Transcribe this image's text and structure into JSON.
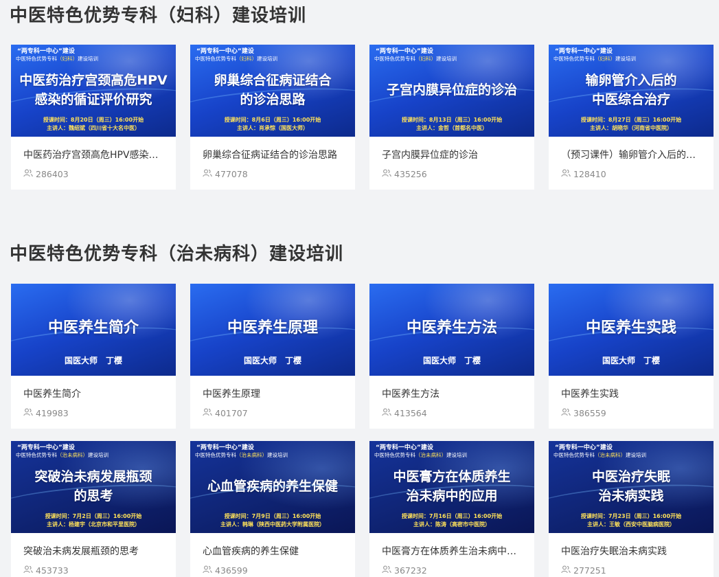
{
  "sections": [
    {
      "title": "中医特色优势专科（妇科）建设培训",
      "courses": [
        {
          "banner_top": "“两专科一中心”建设",
          "banner_sub_pre": "中医特色优势专科",
          "banner_sub_hl": "（妇科）",
          "banner_sub_post": "建设培训",
          "banner_title_1": "中医药治疗宫颈高危HPV",
          "banner_title_2": "感染的循证评价研究",
          "banner_time": "授课时间：8月20日（周三）16:00开始",
          "banner_speaker": "主讲人：魏绍斌（四川省十大名中医）",
          "title": "中医药治疗宫颈高危HPV感染的循证评价研究",
          "views": "286403"
        },
        {
          "banner_top": "“两专科一中心”建设",
          "banner_sub_pre": "中医特色优势专科",
          "banner_sub_hl": "（妇科）",
          "banner_sub_post": "建设培训",
          "banner_title_1": "卵巢综合征病证结合",
          "banner_title_2": "的诊治思路",
          "banner_time": "授课时间：8月6日（周三）16:00开始",
          "banner_speaker": "主讲人：肖承悰（国医大师）",
          "title": "卵巢综合征病证结合的诊治思路",
          "views": "477078"
        },
        {
          "banner_top": "“两专科一中心”建设",
          "banner_sub_pre": "中医特色优势专科",
          "banner_sub_hl": "（妇科）",
          "banner_sub_post": "建设培训",
          "banner_title_1": "子宫内膜异位症的诊治",
          "banner_title_2": "",
          "banner_time": "授课时间：8月13日（周三）16:00开始",
          "banner_speaker": "主讲人：金哲（首都名中医）",
          "title": "子宫内膜异位症的诊治",
          "views": "435256"
        },
        {
          "banner_top": "“两专科一中心”建设",
          "banner_sub_pre": "中医特色优势专科",
          "banner_sub_hl": "（妇科）",
          "banner_sub_post": "建设培训",
          "banner_title_1": "输卵管介入后的",
          "banner_title_2": "中医综合治疗",
          "banner_time": "授课时间：8月27日（周三）16:00开始",
          "banner_speaker": "主讲人：胡晓华（河南省中医院）",
          "title": "（预习课件）输卵管介入后的中医综合治疗",
          "views": "128410"
        }
      ]
    },
    {
      "title": "中医特色优势专科（治未病科）建设培训",
      "courses": [
        {
          "banner_big": "中医养生简介",
          "banner_teacher": "国医大师　丁樱",
          "title": "中医养生简介",
          "views": "419983"
        },
        {
          "banner_big": "中医养生原理",
          "banner_teacher": "国医大师　丁樱",
          "title": "中医养生原理",
          "views": "401707"
        },
        {
          "banner_big": "中医养生方法",
          "banner_teacher": "国医大师　丁樱",
          "title": "中医养生方法",
          "views": "413564"
        },
        {
          "banner_big": "中医养生实践",
          "banner_teacher": "国医大师　丁樱",
          "title": "中医养生实践",
          "views": "386559"
        },
        {
          "banner_top": "“两专科一中心”建设",
          "banner_sub_pre": "中医特色优势专科",
          "banner_sub_hl": "（治未病科）",
          "banner_sub_post": "建设培训",
          "banner_title_1": "突破治未病发展瓶颈",
          "banner_title_2": "的思考",
          "banner_time": "授课时间：7月2日（周三）16:00开始",
          "banner_speaker": "主讲人：杨建宇（北京市和平里医院）",
          "title": "突破治未病发展瓶颈的思考",
          "views": "453733"
        },
        {
          "banner_top": "“两专科一中心”建设",
          "banner_sub_pre": "中医特色优势专科",
          "banner_sub_hl": "（治未病科）",
          "banner_sub_post": "建设培训",
          "banner_title_1": "心血管疾病的养生保健",
          "banner_title_2": "",
          "banner_time": "授课时间：7月9日（周三）16:00开始",
          "banner_speaker": "主讲人：韩琳（陕西中医药大学附属医院）",
          "title": "心血管疾病的养生保健",
          "views": "436599"
        },
        {
          "banner_top": "“两专科一中心”建设",
          "banner_sub_pre": "中医特色优势专科",
          "banner_sub_hl": "（治未病科）",
          "banner_sub_post": "建设培训",
          "banner_title_1": "中医膏方在体质养生",
          "banner_title_2": "治未病中的应用",
          "banner_time": "授课时间：7月16日（周三）16:00开始",
          "banner_speaker": "主讲人：陈涛（高密市中医院）",
          "title": "中医膏方在体质养生治未病中的应用",
          "views": "367232"
        },
        {
          "banner_top": "“两专科一中心”建设",
          "banner_sub_pre": "中医特色优势专科",
          "banner_sub_hl": "（治未病科）",
          "banner_sub_post": "建设培训",
          "banner_title_1": "中医治疗失眠",
          "banner_title_2": "治未病实践",
          "banner_time": "授课时间：7月23日（周三）16:00开始",
          "banner_speaker": "主讲人：王敏（西安中医脑病医院）",
          "title": "中医治疗失眠治未病实践",
          "views": "277251"
        }
      ]
    }
  ],
  "icons": {
    "views": "user-group-icon"
  },
  "colors": {
    "page_bg": "#f2f3f5",
    "banner_blue": "#1743c9",
    "banner_highlight": "#ffe25a",
    "meta_text": "#888888"
  }
}
